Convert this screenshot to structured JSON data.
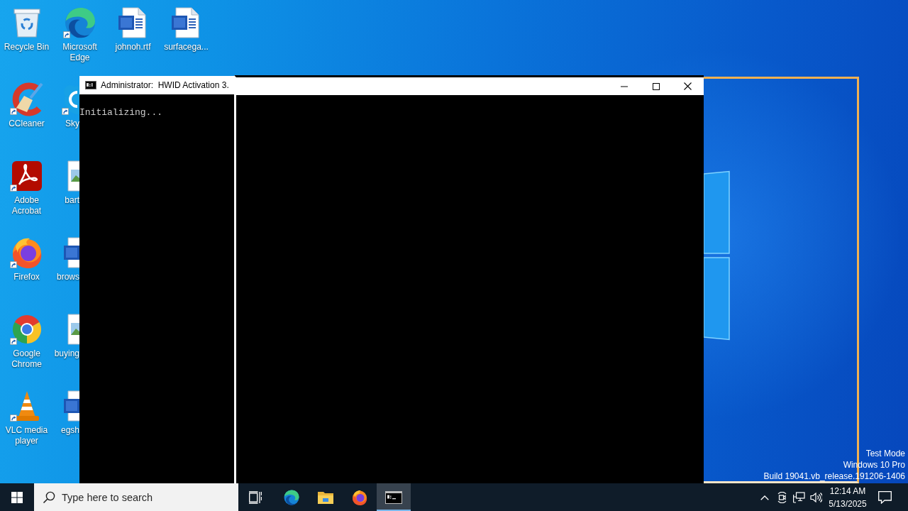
{
  "desktop_icons": {
    "columns": [
      [
        {
          "label": "Recycle Bin",
          "kind": "recycle-bin",
          "shortcut": false,
          "cut_off": false
        },
        {
          "label": "CCleaner",
          "kind": "ccleaner",
          "shortcut": true,
          "cut_off": false
        },
        {
          "label": "Adobe Acrobat",
          "kind": "acrobat",
          "shortcut": true,
          "cut_off": false
        },
        {
          "label": "Firefox",
          "kind": "firefox",
          "shortcut": true,
          "cut_off": false
        },
        {
          "label": "Google Chrome",
          "kind": "chrome",
          "shortcut": true,
          "cut_off": false
        },
        {
          "label": "VLC media player",
          "kind": "vlc",
          "shortcut": true,
          "cut_off": false
        }
      ],
      [
        {
          "label": "Microsoft Edge",
          "kind": "edge",
          "shortcut": true,
          "cut_off": false
        },
        {
          "label": "Sky",
          "kind": "skype",
          "shortcut": true,
          "cut_off": true
        },
        {
          "label": "bart",
          "kind": "image-file",
          "shortcut": false,
          "cut_off": true
        },
        {
          "label": "brows",
          "kind": "word-doc",
          "shortcut": false,
          "cut_off": true
        },
        {
          "label": "buying",
          "kind": "image-file",
          "shortcut": false,
          "cut_off": true
        },
        {
          "label": "egsh",
          "kind": "word-doc",
          "shortcut": false,
          "cut_off": true
        }
      ],
      [
        {
          "label": "johnoh.rtf",
          "kind": "word-doc",
          "shortcut": false,
          "cut_off": false
        }
      ],
      [
        {
          "label": "surfacega...",
          "kind": "word-doc",
          "shortcut": false,
          "cut_off": false
        }
      ]
    ]
  },
  "console_window": {
    "title": "Administrator:  HWID Activation 3.",
    "output": [
      "Initializing..."
    ]
  },
  "system_text": [
    "Test Mode",
    "Windows 10 Pro",
    "Build 19041.vb_release.191206-1406"
  ],
  "taskbar": {
    "search": {
      "placeholder": "Type here to search"
    },
    "apps": [
      {
        "kind": "edge",
        "selected": false
      },
      {
        "kind": "folder",
        "selected": false
      },
      {
        "kind": "firefox",
        "selected": false
      },
      {
        "kind": "console",
        "selected": true
      }
    ],
    "clock": {
      "time": "12:14 AM",
      "date": "5/13/2025"
    }
  }
}
